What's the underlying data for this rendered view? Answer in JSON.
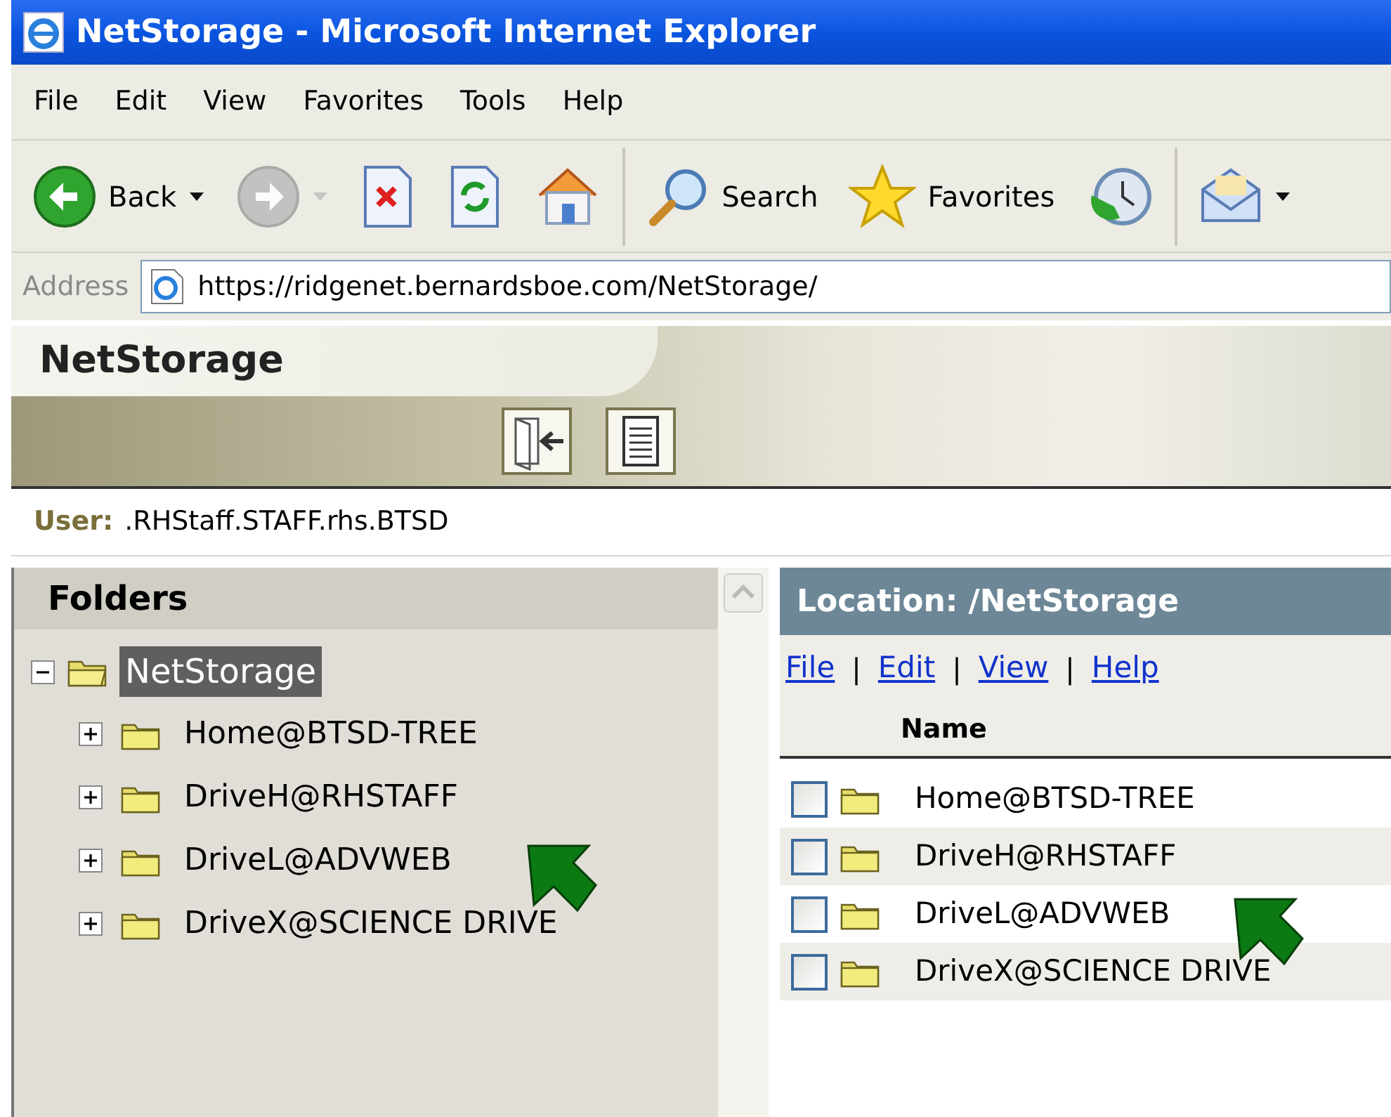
{
  "window": {
    "title": "NetStorage - Microsoft Internet Explorer"
  },
  "menu": [
    "File",
    "Edit",
    "View",
    "Favorites",
    "Tools",
    "Help"
  ],
  "toolbar": [
    {
      "kind": "back",
      "label": "Back",
      "disabled": false
    },
    {
      "kind": "forward",
      "disabled": true
    },
    {
      "kind": "stop",
      "disabled": false
    },
    {
      "kind": "refresh",
      "disabled": false
    },
    {
      "kind": "home",
      "disabled": false
    },
    {
      "kind": "search",
      "label": "Search",
      "disabled": false
    },
    {
      "kind": "favorites",
      "label": "Favorites",
      "disabled": false
    },
    {
      "kind": "history",
      "disabled": false
    },
    {
      "kind": "mail",
      "disabled": false
    }
  ],
  "address": {
    "label": "Address",
    "value": "https://ridgenet.bernardsboe.com/NetStorage/"
  },
  "banner": {
    "title": "NetStorage"
  },
  "user": {
    "label": "User:",
    "value": ".RHStaff.STAFF.rhs.BTSD"
  },
  "folders": {
    "title": "Folders",
    "tree": [
      {
        "label": "NetStorage",
        "selected": true,
        "expanded": true,
        "children": [
          {
            "label": "Home@BTSD-TREE",
            "selected": false,
            "expanded": false
          },
          {
            "label": "DriveH@RHSTAFF",
            "selected": false,
            "expanded": false
          },
          {
            "label": "DriveL@ADVWEB",
            "selected": false,
            "expanded": false
          },
          {
            "label": "DriveX@SCIENCE DRIVE",
            "selected": false,
            "expanded": false
          }
        ]
      }
    ]
  },
  "location": {
    "title": "Location: /NetStorage",
    "menu": [
      "File",
      "Edit",
      "View",
      "Help"
    ],
    "separator": "|",
    "column": "Name",
    "rows": [
      {
        "name": "Home@BTSD-TREE",
        "checked": false
      },
      {
        "name": "DriveH@RHSTAFF",
        "checked": false
      },
      {
        "name": "DriveL@ADVWEB",
        "checked": false
      },
      {
        "name": "DriveX@SCIENCE DRIVE",
        "checked": false
      }
    ]
  }
}
